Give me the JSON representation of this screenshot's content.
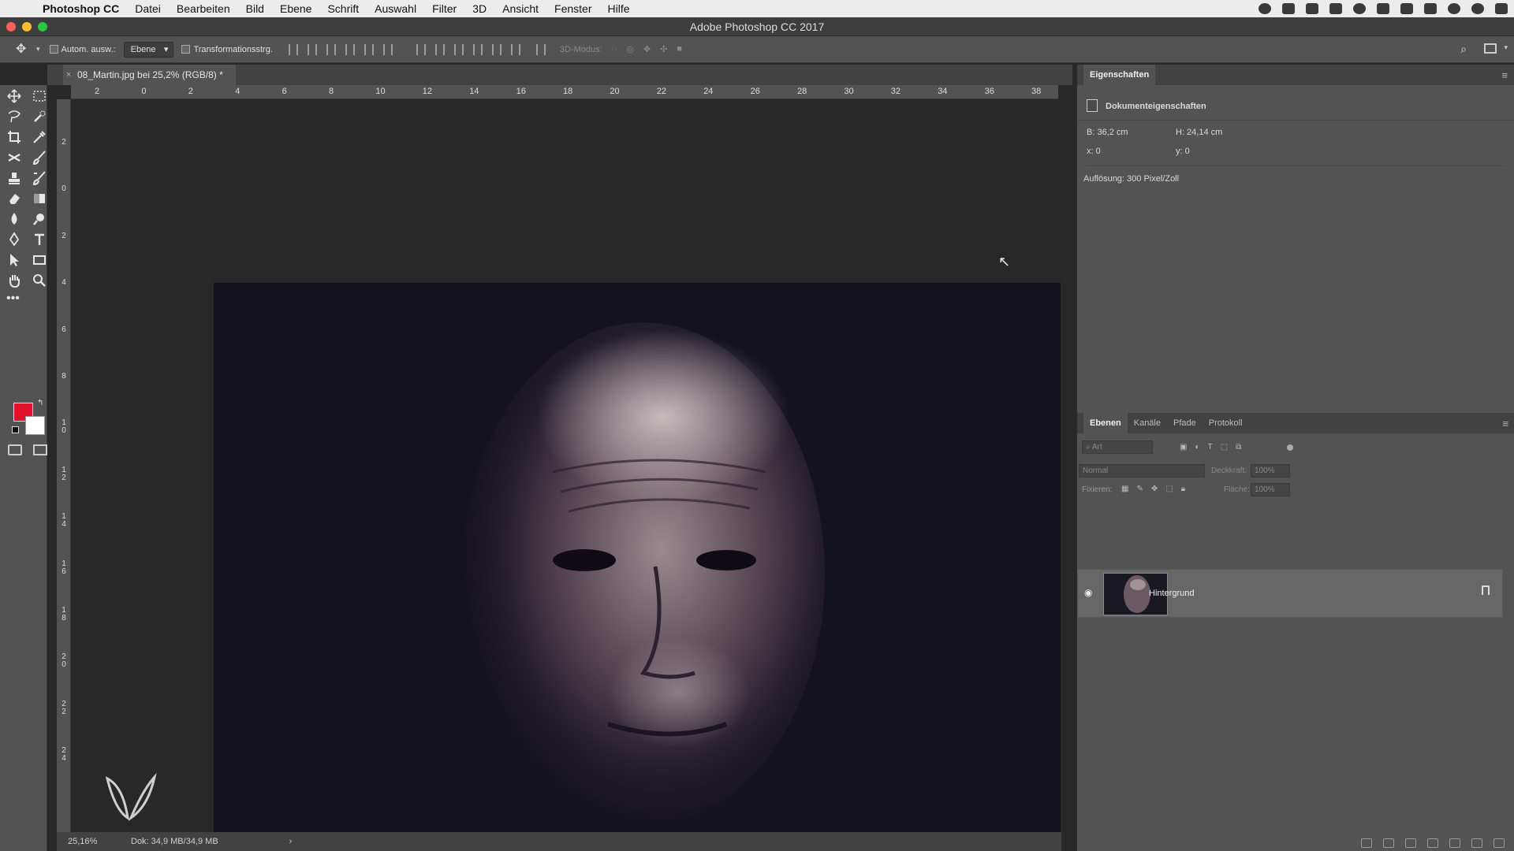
{
  "menubar": {
    "app": "Photoshop CC",
    "menus": [
      "Datei",
      "Bearbeiten",
      "Bild",
      "Ebene",
      "Schrift",
      "Auswahl",
      "Filter",
      "3D",
      "Ansicht",
      "Fenster",
      "Hilfe"
    ]
  },
  "window": {
    "title": "Adobe Photoshop CC 2017"
  },
  "options": {
    "auto_select_label": "Autom. ausw.:",
    "auto_select_value": "Ebene",
    "transform_label": "Transformationsstrg.",
    "mode_3d": "3D-Modus:"
  },
  "document": {
    "tab_title": "08_Martin.jpg bei 25,2% (RGB/8) *",
    "close": "×"
  },
  "ruler": {
    "top_ticks": [
      "2",
      "0",
      "2",
      "4",
      "6",
      "8",
      "10",
      "12",
      "14",
      "16",
      "18",
      "20",
      "22",
      "24",
      "26",
      "28",
      "30",
      "32",
      "34",
      "36",
      "38"
    ],
    "left_ticks": [
      "2",
      "0",
      "2",
      "4",
      "6",
      "8",
      "10",
      "12",
      "14",
      "16",
      "18",
      "20",
      "22",
      "24"
    ]
  },
  "status": {
    "zoom": "25,16%",
    "doc": "Dok: 34,9 MB/34,9 MB",
    "arrow": "›"
  },
  "properties": {
    "title": "Eigenschaften",
    "section": "Dokumenteigenschaften",
    "width": "B:  36,2 cm",
    "height": "H:  24,14 cm",
    "x": "x:  0",
    "y": "y:  0",
    "resolution": "Auflösung: 300 Pixel/Zoll"
  },
  "layers": {
    "tabs": [
      "Ebenen",
      "Kanäle",
      "Pfade",
      "Protokoll"
    ],
    "search_placeholder": "Art",
    "blend_mode": "Normal",
    "opacity_label": "Deckkraft:",
    "opacity_value": "100%",
    "lock_label": "Fixieren:",
    "fill_label": "Fläche:",
    "fill_value": "100%",
    "layer_name": "Hintergrund"
  },
  "colors": {
    "foreground": "#e0122b",
    "background": "#ffffff",
    "canvas_bg": "#282828",
    "panel_bg": "#535353"
  }
}
